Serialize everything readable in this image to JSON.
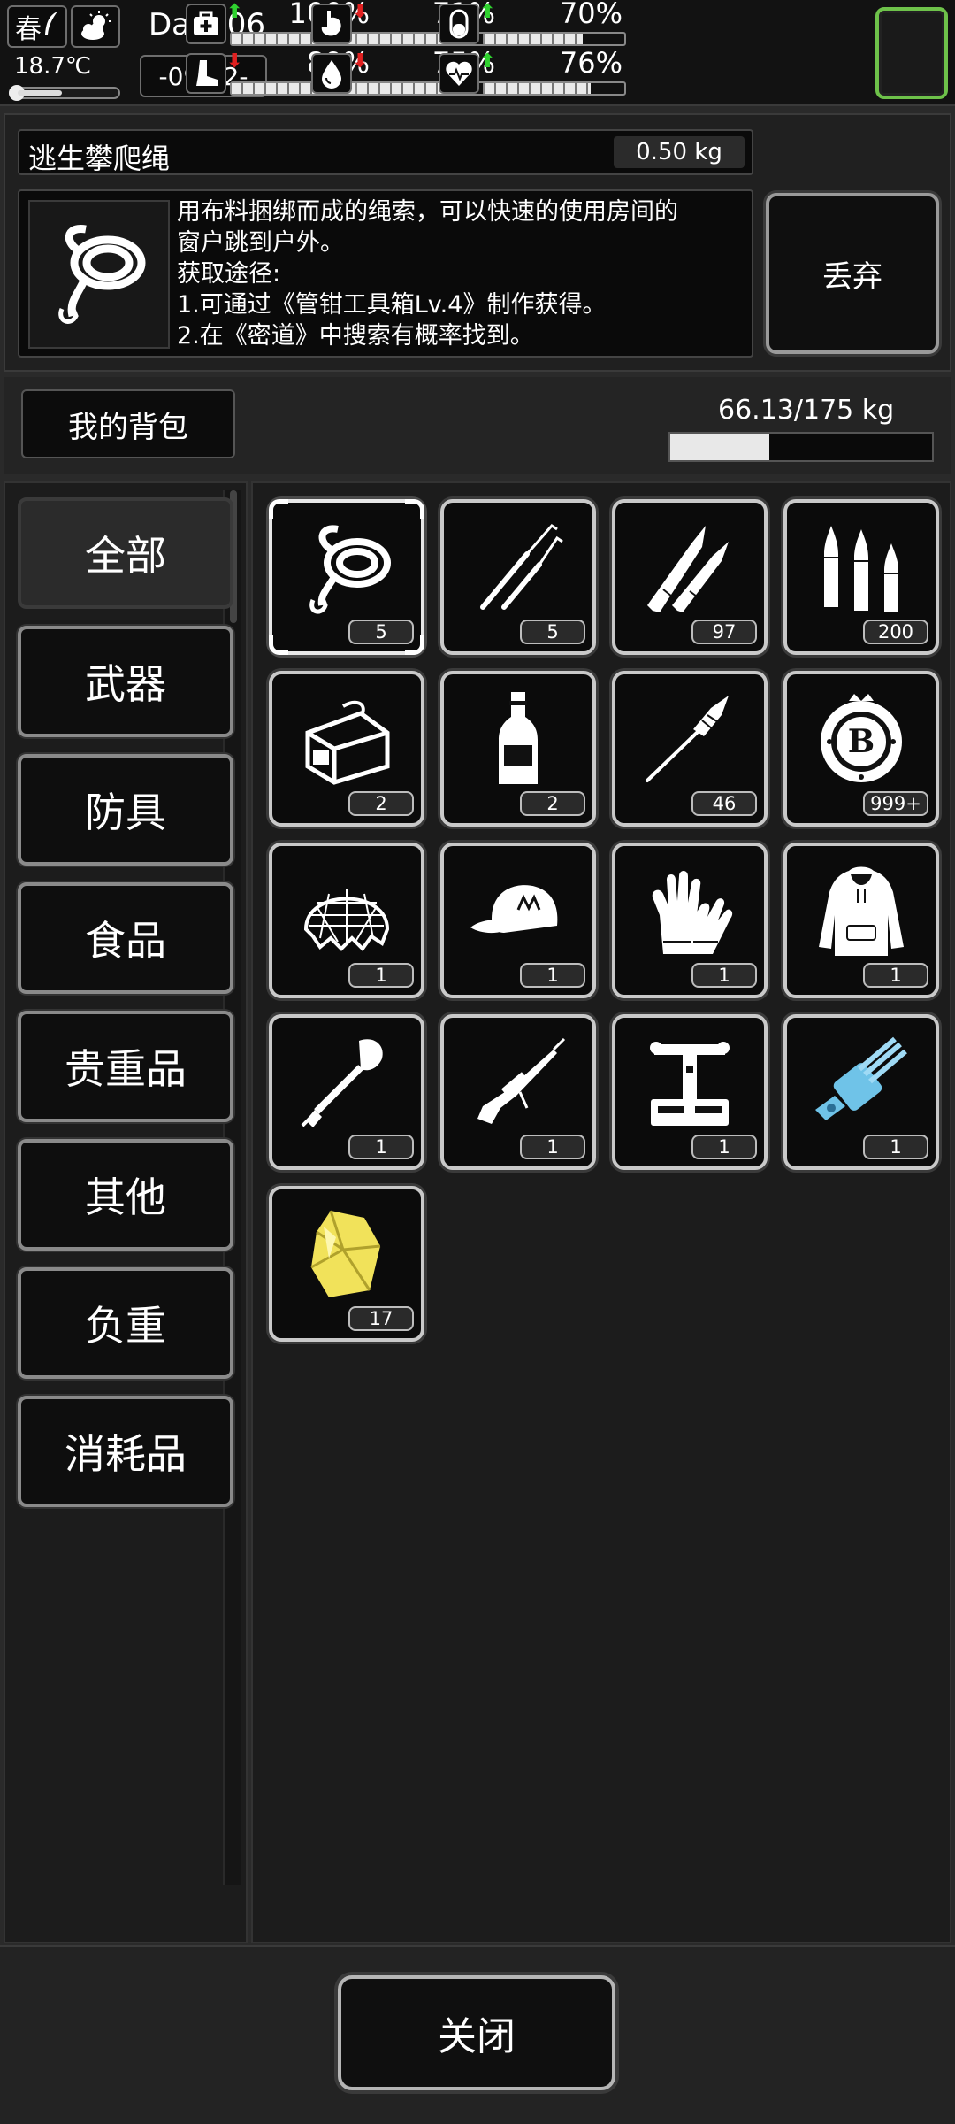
{
  "status": {
    "season": "春",
    "temperature": "18.7℃",
    "temperature_fraction": 0.45,
    "day": "Day206",
    "time": "-09:22-",
    "stats": [
      {
        "icon": "health-kit-icon",
        "trend": "up",
        "value": "100%",
        "fraction": 1.0
      },
      {
        "icon": "stomach-icon",
        "trend": "down",
        "value": "71%",
        "fraction": 0.71
      },
      {
        "icon": "pill-icon",
        "trend": "up",
        "value": "70%",
        "fraction": 0.7
      },
      {
        "icon": "foot-icon",
        "trend": "down",
        "value": "89%",
        "fraction": 0.89
      },
      {
        "icon": "water-drop-icon",
        "trend": "down",
        "value": "75%",
        "fraction": 0.75
      },
      {
        "icon": "heart-icon",
        "trend": "up",
        "value": "76%",
        "fraction": 0.76
      }
    ],
    "colors": {
      "trend_up": "#2fd12f",
      "trend_down": "#e02020",
      "accent_green": "#6ec24a"
    }
  },
  "selected_item": {
    "name": "逃生攀爬绳",
    "weight": "0.50 kg",
    "description_lines": [
      "用布料捆绑而成的绳索，可以快速的使用房间的",
      "窗户跳到户外。",
      "获取途径:",
      "1.可通过《管钳工具箱Lv.4》制作获得。",
      "2.在《密道》中搜索有概率找到。"
    ],
    "drop_label": "丢弃"
  },
  "backpack": {
    "title": "我的背包",
    "capacity": "66.13/175 kg",
    "capacity_fraction": 0.378
  },
  "categories": [
    "全部",
    "武器",
    "防具",
    "食品",
    "贵重品",
    "其他",
    "负重",
    "消耗品"
  ],
  "active_category": 0,
  "items": [
    {
      "icon": "rope-icon",
      "count": "5"
    },
    {
      "icon": "tweezers-icon",
      "count": "5"
    },
    {
      "icon": "rifle-bullets-icon",
      "count": "97"
    },
    {
      "icon": "ammo-cartridges-icon",
      "count": "200"
    },
    {
      "icon": "canned-food-icon",
      "count": "2"
    },
    {
      "icon": "liquor-bottle-icon",
      "count": "2"
    },
    {
      "icon": "rocket-grenade-icon",
      "count": "46"
    },
    {
      "icon": "bitcoin-chip-icon",
      "count": "999+"
    },
    {
      "icon": "camo-net-helmet-icon",
      "count": "1"
    },
    {
      "icon": "baseball-cap-icon",
      "count": "1"
    },
    {
      "icon": "gloves-icon",
      "count": "1"
    },
    {
      "icon": "hoodie-icon",
      "count": "1"
    },
    {
      "icon": "shovel-icon",
      "count": "1"
    },
    {
      "icon": "sniper-rifle-icon",
      "count": "1"
    },
    {
      "icon": "machine-rack-icon",
      "count": "1"
    },
    {
      "icon": "minigun-icon",
      "count": "1"
    },
    {
      "icon": "yellow-crystal-icon",
      "count": "17"
    }
  ],
  "close_label": "关闭"
}
